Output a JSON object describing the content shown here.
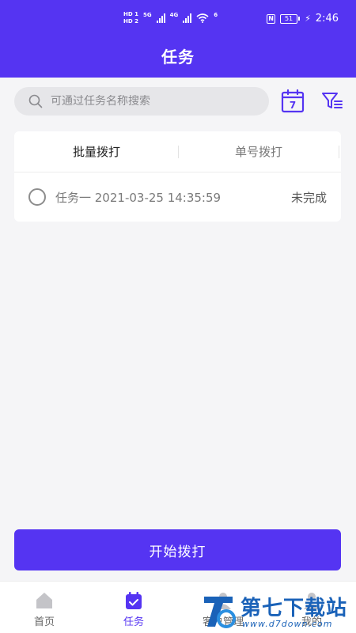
{
  "status_bar": {
    "hd1": "HD 1",
    "hd2": "HD 2",
    "net1": "5G",
    "net2": "4G",
    "wifi": "6",
    "battery": "51",
    "time": "2:46",
    "nfc": "N"
  },
  "header": {
    "title": "任务"
  },
  "search": {
    "placeholder": "可通过任务名称搜索",
    "icon": "search-icon"
  },
  "toolbar": {
    "calendar_day": "7",
    "calendar_icon": "calendar-icon",
    "filter_icon": "filter-icon"
  },
  "tabs": [
    {
      "label": "批量拨打",
      "active": true
    },
    {
      "label": "单号拨打",
      "active": false
    }
  ],
  "tasks": [
    {
      "name": "任务一 2021-03-25 14:35:59",
      "status": "未完成",
      "checked": false
    }
  ],
  "start_button": {
    "label": "开始拨打"
  },
  "bottom_nav": [
    {
      "label": "首页",
      "icon": "home-icon",
      "active": false
    },
    {
      "label": "任务",
      "icon": "task-calendar-icon",
      "active": true
    },
    {
      "label": "客户管理",
      "icon": "user-icon",
      "active": false
    },
    {
      "label": "我的",
      "icon": "user-icon",
      "active": false
    }
  ],
  "watermark": {
    "text": "第七下载站",
    "url": "www.d7down.com"
  },
  "colors": {
    "brand": "#5534f2",
    "background": "#f5f5f7",
    "watermark": "#1a62b8"
  }
}
